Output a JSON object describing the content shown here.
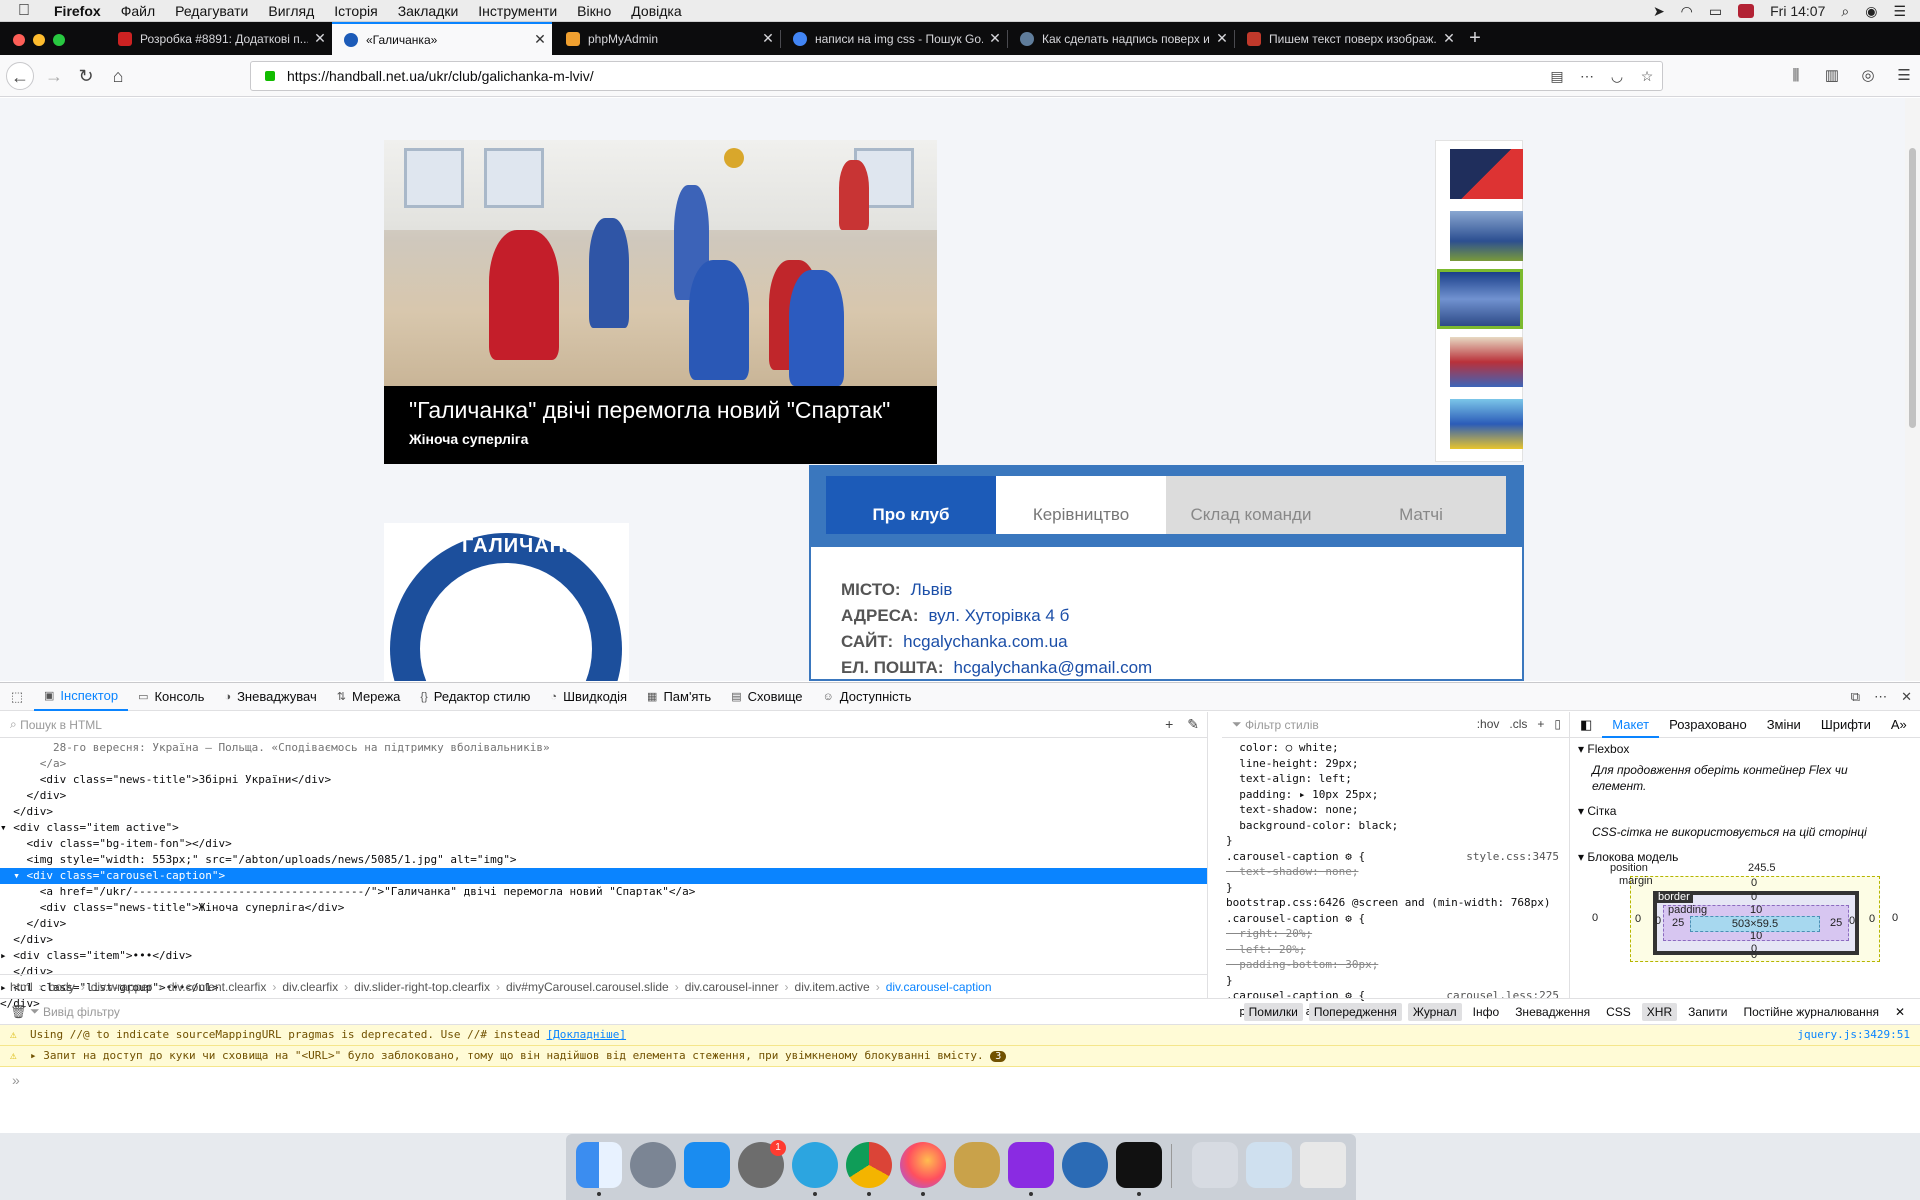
{
  "menubar": {
    "app": "Firefox",
    "items": [
      "Файл",
      "Редагувати",
      "Вигляд",
      "Історія",
      "Закладки",
      "Інструменти",
      "Вікно",
      "Довідка"
    ],
    "clock": "Fri 14:07"
  },
  "tabs": [
    {
      "title": "Розробка #8891: Додаткові п...",
      "active": false,
      "favicon_color": "#c22"
    },
    {
      "title": "«Галичанка»",
      "active": true,
      "favicon_color": "#1c5bb8"
    },
    {
      "title": "phpMyAdmin",
      "active": false,
      "favicon_color": "#f0a030"
    },
    {
      "title": "написи на img css - Пошук Go...",
      "active": false,
      "favicon_color": "#4285f4"
    },
    {
      "title": "Как сделать надпись поверх и...",
      "active": false,
      "favicon_color": "#607d9b"
    },
    {
      "title": "Пишем текст поверх изображ...",
      "active": false,
      "favicon_color": "#c0392b"
    }
  ],
  "address": {
    "url": "https://handball.net.ua/ukr/club/galichanka-m-lviv/"
  },
  "page": {
    "carousel": {
      "title": "\"Галичанка\" двічі перемогла новий \"Спартак\"",
      "subtitle": "Жіноча суперліга"
    },
    "logo_text": "ГАЛИЧАНКА",
    "club_tabs": [
      "Про клуб",
      "Керівництво",
      "Склад команди",
      "Матчі"
    ],
    "info": [
      {
        "label": "МІСТО:",
        "value": "Львів"
      },
      {
        "label": "АДРЕСА:",
        "value": "вул. Хуторівка 4 б"
      },
      {
        "label": "САЙТ:",
        "value": "hcgalychanka.com.ua"
      },
      {
        "label": "ЕЛ. ПОШТА:",
        "value": "hcgalychanka@gmail.com"
      }
    ]
  },
  "devtools": {
    "tabs": [
      "Інспектор",
      "Консоль",
      "Зневаджувач",
      "Мережа",
      "Редактор стилю",
      "Швидкодія",
      "Пам'ять",
      "Сховище",
      "Доступність"
    ],
    "markup_search_placeholder": "Пошук в HTML",
    "markup_lines": [
      {
        "text": "        28-го вересня: Україна — Польща. «Сподіваємось на підтримку вболівальників»",
        "cls": "dim"
      },
      {
        "text": "      </a>",
        "cls": "dim"
      },
      {
        "text": "      <div class=\"news-title\">Збірні України</div>",
        "cls": ""
      },
      {
        "text": "    </div>",
        "cls": ""
      },
      {
        "text": "  </div>",
        "cls": ""
      },
      {
        "text": "▾ <div class=\"item active\">",
        "cls": ""
      },
      {
        "text": "    <div class=\"bg-item-fon\"></div>",
        "cls": ""
      },
      {
        "text": "    <img style=\"width: 553px;\" src=\"/abton/uploads/news/5085/1.jpg\" alt=\"img\">",
        "cls": ""
      },
      {
        "text": "  ▾ <div class=\"carousel-caption\">",
        "cls": "sel"
      },
      {
        "text": "      <a href=\"/ukr/-----------------------------------/\">\"Галичанка\" двічі перемогла новий \"Спартак\"</a>",
        "cls": ""
      },
      {
        "text": "      <div class=\"news-title\">Жіноча суперліга</div>",
        "cls": ""
      },
      {
        "text": "    </div>",
        "cls": ""
      },
      {
        "text": "  </div>",
        "cls": ""
      },
      {
        "text": "▸ <div class=\"item\">•••</div>",
        "cls": ""
      },
      {
        "text": "  </div>",
        "cls": ""
      },
      {
        "text": "▸ <ul class=\"list-group\">•••</ul>",
        "cls": ""
      },
      {
        "text": "</div>",
        "cls": ""
      }
    ],
    "breadcrumbs": [
      "html",
      "body",
      "div.wrapper",
      "div.content.clearfix",
      "div.clearfix",
      "div.slider-right-top.clearfix",
      "div#myCarousel.carousel.slide",
      "div.carousel-inner",
      "div.item.active",
      "div.carousel-caption"
    ],
    "rules_filter_placeholder": "Фільтр стилів",
    "rules_buttons": [
      ":hov",
      ".cls"
    ],
    "rule_lines": [
      {
        "text": "  color: ○ white;",
        "src": ""
      },
      {
        "text": "  line-height: 29px;",
        "src": ""
      },
      {
        "text": "  text-align: left;",
        "src": ""
      },
      {
        "text": "  padding: ▸ 10px 25px;",
        "src": ""
      },
      {
        "text": "  text-shadow: none;",
        "src": ""
      },
      {
        "text": "  background-color: black;",
        "src": ""
      },
      {
        "text": "}",
        "src": ""
      },
      {
        "text": ".carousel-caption ⚙ {",
        "src": "style.css:3475"
      },
      {
        "text": "  text-shadow: none;",
        "src": "",
        "strike": true
      },
      {
        "text": "}",
        "src": ""
      },
      {
        "text": "bootstrap.css:6426 @screen and (min-width: 768px)",
        "src": ""
      },
      {
        "text": ".carousel-caption ⚙ {",
        "src": ""
      },
      {
        "text": "  right: 20%;",
        "src": "",
        "strike": true
      },
      {
        "text": "  left: 20%;",
        "src": "",
        "strike": true
      },
      {
        "text": "  padding-bottom: 30px;",
        "src": "",
        "strike": true
      },
      {
        "text": "}",
        "src": ""
      },
      {
        "text": ".carousel-caption ⚙ {",
        "src": "carousel.less:225"
      },
      {
        "text": "  position: absolute;",
        "src": ""
      }
    ],
    "layout_tabs": [
      "Макет",
      "Розраховано",
      "Зміни",
      "Шрифти",
      "А»"
    ],
    "flexbox_title": "Flexbox",
    "flexbox_note": "Для продовження оберіть контейнер Flex чи елемент.",
    "grid_title": "Сітка",
    "grid_note": "CSS-сітка не використовується на цій сторінці",
    "boxmodel_title": "Блокова модель",
    "boxmodel": {
      "position_label": "position",
      "position_value": "245.5",
      "margin_label": "margin",
      "border_label": "border",
      "padding_label": "padding",
      "content_size": "503×59.5",
      "margin_top": "0",
      "margin_bottom": "0",
      "margin_left": "0",
      "margin_right": "0",
      "border_top": "0",
      "border_bottom": "0",
      "border_left": "0",
      "border_right": "0",
      "padding_top": "10",
      "padding_bottom": "10",
      "padding_left": "25",
      "padding_right": "25",
      "outer_left": "0",
      "outer_right": "0"
    },
    "console_filter_placeholder": "Вивід фільтру",
    "console_filters": [
      "Помилки",
      "Попередження",
      "Журнал",
      "Інфо",
      "Зневадження",
      "CSS",
      "XHR",
      "Запити"
    ],
    "console_persist": "Постійне журналювання",
    "console_messages": [
      {
        "text": "Using //@ to indicate sourceMappingURL pragmas is deprecated. Use //# instead ",
        "link": "[Докладніше]",
        "src": "jquery.js:3429:51",
        "count": ""
      },
      {
        "text": "▸ Запит на доступ до куки чи сховища на \"<URL>\" було заблоковано, тому що він надійшов від елемента стеження, при увімкненому блокуванні вмісту. ",
        "link": "",
        "src": "",
        "count": "3"
      }
    ],
    "console_prompt": "»"
  }
}
